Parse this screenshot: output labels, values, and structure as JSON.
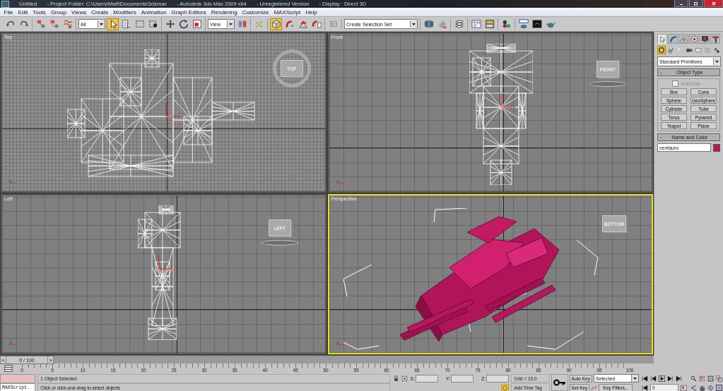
{
  "window": {
    "title": [
      "Untitled",
      "- Project Folder: C:\\Users\\Matt\\Documents\\3dsmax",
      "- Autodesk 3ds Max  2009 x64",
      "- Unregistered Version",
      "- Display : Direct 3D"
    ]
  },
  "menu": [
    "File",
    "Edit",
    "Tools",
    "Group",
    "Views",
    "Create",
    "Modifiers",
    "Animation",
    "Graph Editors",
    "Rendering",
    "Customize",
    "MAXScript",
    "Help"
  ],
  "toolbar": [
    [
      {
        "kind": "button",
        "selected": false
      },
      {
        "kind": "button",
        "selected": false
      }
    ],
    [
      {
        "kind": "button",
        "selected": false
      },
      {
        "kind": "button",
        "selected": false
      },
      {
        "kind": "button",
        "selected": false
      }
    ],
    [
      {
        "kind": "dropdown",
        "value": "All"
      },
      {
        "kind": "button",
        "selected": true
      },
      {
        "kind": "button",
        "selected": false
      },
      {
        "kind": "button",
        "selected": false
      },
      {
        "kind": "button",
        "selected": false
      }
    ],
    [
      {
        "kind": "button",
        "selected": false
      },
      {
        "kind": "button",
        "selected": false
      },
      {
        "kind": "button",
        "selected": false
      }
    ],
    [
      {
        "kind": "dropdown",
        "value": "View"
      },
      {
        "kind": "button",
        "selected": false
      }
    ],
    [
      {
        "kind": "button",
        "selected": false
      }
    ],
    [
      {
        "kind": "button",
        "selected": true
      },
      {
        "kind": "button",
        "selected": false
      },
      {
        "kind": "button",
        "selected": false
      },
      {
        "kind": "button",
        "selected": false
      }
    ],
    [
      {
        "kind": "button",
        "selected": false
      }
    ],
    [
      {
        "kind": "dropdown",
        "value": "Create Selection Set"
      }
    ],
    [
      {
        "kind": "button",
        "selected": false
      },
      {
        "kind": "button",
        "selected": false
      }
    ],
    [
      {
        "kind": "button",
        "selected": false
      }
    ],
    [
      {
        "kind": "button",
        "selected": false
      },
      {
        "kind": "button",
        "selected": false
      }
    ],
    [
      {
        "kind": "button",
        "selected": false
      }
    ],
    [
      {
        "kind": "button",
        "selected": false
      },
      {
        "kind": "button",
        "selected": false
      },
      {
        "kind": "button",
        "selected": false
      }
    ]
  ],
  "viewports": [
    {
      "label": "Top",
      "kind": "top",
      "selected": false,
      "viewcube": {
        "label": "TOP",
        "ring": true,
        "base": false
      }
    },
    {
      "label": "Front",
      "kind": "front",
      "selected": false,
      "viewcube": {
        "label": "FRONT",
        "ring": false,
        "base": true
      }
    },
    {
      "label": "Left",
      "kind": "left",
      "selected": false,
      "viewcube": {
        "label": "LEFT",
        "ring": false,
        "base": true
      }
    },
    {
      "label": "Perspective",
      "kind": "perspective",
      "selected": true,
      "viewcube": {
        "label": "BOTTOM",
        "ring": false,
        "base": false
      }
    }
  ],
  "command_panel": {
    "tabs": [
      {
        "selected": true
      },
      {
        "selected": false
      },
      {
        "selected": false
      },
      {
        "selected": false
      },
      {
        "selected": false
      },
      {
        "selected": false
      }
    ],
    "categories": [
      {
        "selected": true
      },
      {
        "selected": false
      },
      {
        "selected": false
      },
      {
        "selected": false
      },
      {
        "selected": false
      },
      {
        "selected": false
      },
      {
        "selected": false
      }
    ],
    "dropdown": "Standard Primitives",
    "rollouts": [
      {
        "kind": "object_type",
        "toggle": "-",
        "title": "Object Type",
        "autogrid": {
          "label": "AutoGrid",
          "checked": false,
          "disabled": true
        },
        "buttons": [
          "Box",
          "Cone",
          "Sphere",
          "GeoSphere",
          "Cylinder",
          "Tube",
          "Torus",
          "Pyramid",
          "Teapot",
          "Plane"
        ]
      },
      {
        "kind": "name_color",
        "toggle": "-",
        "title": "Name and Color",
        "name": "centauro",
        "color": "#c0145a"
      }
    ]
  },
  "time_slider": {
    "prev": "<",
    "frame": "0 / 100",
    "next": ">",
    "level": 0
  },
  "track_bar": {
    "ticks": [
      "0",
      "5",
      "10",
      "15",
      "20",
      "25",
      "30",
      "35",
      "40",
      "45",
      "50",
      "55",
      "60",
      "65",
      "70",
      "75",
      "80",
      "85",
      "90",
      "95",
      "100"
    ]
  },
  "status": {
    "maxscript": "MAXScript.",
    "selection": "1 Object Selected",
    "prompt": "Click or click-and-drag to select objects",
    "x_label": "X:",
    "y_label": "Y:",
    "z_label": "Z:",
    "grid": "Grid = 10.0",
    "time_tag": "Add Time Tag",
    "auto_key": "Auto Key",
    "set_key": "Set Key",
    "key_mode": "Selected",
    "key_filters": "Key Filters...",
    "current_frame": "0"
  }
}
